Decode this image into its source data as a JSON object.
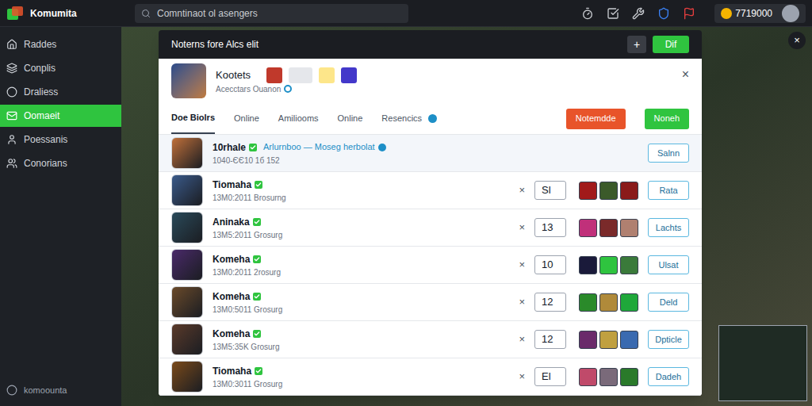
{
  "app": {
    "name": "Komumita"
  },
  "search": {
    "placeholder": "Comntinaot ol asengers"
  },
  "coins": "7719000",
  "sidebar": {
    "items": [
      {
        "label": "Raddes",
        "selected": false
      },
      {
        "label": "Conplis",
        "selected": false
      },
      {
        "label": "Draliess",
        "selected": false
      },
      {
        "label": "Oomaeit",
        "selected": true
      },
      {
        "label": "Poessanis",
        "selected": false
      },
      {
        "label": "Conorians",
        "selected": false
      }
    ],
    "footer": "komoounta"
  },
  "overlay_close": "×",
  "dialog": {
    "title": "Noterns fore Alcs elit",
    "add": "+",
    "confirm": "Dif",
    "close": "×",
    "profile": {
      "name": "Kootets",
      "subtitle": "Acecctars Ouanon"
    },
    "tabs": [
      {
        "label": "Doe Biolrs",
        "selected": true
      },
      {
        "label": "Online",
        "selected": false
      },
      {
        "label": "Amiliooms",
        "selected": false
      },
      {
        "label": "Online",
        "selected": false
      },
      {
        "label": "Resencics",
        "selected": false
      }
    ],
    "actions": [
      {
        "label": "Notemdde",
        "color": "#e8542a"
      },
      {
        "label": "Noneh",
        "color": "#2fc43f"
      }
    ],
    "rows": [
      {
        "kind": "request",
        "name": "10rhale",
        "link": "Arlurnboo — Moseg herbolat",
        "detail": "1040-ЄЄ10 1б 152",
        "button": "Salnn",
        "highlighted": true,
        "color": "#c0703a"
      },
      {
        "kind": "friend",
        "name": "Tiomaha",
        "detail": "13M0:2011 Brosurng",
        "remove": "×",
        "count": "Sl",
        "button": "Rata",
        "highlighted": false,
        "color": "#3a5a8a",
        "items": [
          {
            "color": "#a11a1a"
          },
          {
            "color": "#3b5a2a"
          },
          {
            "color": "#8a1a1a"
          }
        ]
      },
      {
        "kind": "friend",
        "name": "Aninaka",
        "detail": "13M5:2011 Grosurg",
        "remove": "×",
        "count": "13",
        "button": "Lachts",
        "highlighted": false,
        "color": "#2a4a5a",
        "items": [
          {
            "color": "#c0307a"
          },
          {
            "color": "#7a2a2a"
          },
          {
            "color": "#b08070"
          }
        ]
      },
      {
        "kind": "friend",
        "name": "Komeha",
        "detail": "13M0:2011 2rosurg",
        "remove": "×",
        "count": "10",
        "button": "Ulsat",
        "highlighted": false,
        "color": "#4a2a6a",
        "items": [
          {
            "color": "#1a1a3a"
          },
          {
            "color": "#2fc43f"
          },
          {
            "color": "#3a7a3a"
          }
        ]
      },
      {
        "kind": "friend",
        "name": "Komeha",
        "detail": "13M0:5011 Grosurg",
        "remove": "×",
        "count": "12",
        "button": "Deld",
        "highlighted": false,
        "color": "#6a4a2a",
        "items": [
          {
            "color": "#2a8a2a"
          },
          {
            "color": "#b08a3a"
          },
          {
            "color": "#1fa83a"
          }
        ]
      },
      {
        "kind": "friend",
        "name": "Komeha",
        "detail": "13M5:35K Grosurg",
        "remove": "×",
        "count": "12",
        "button": "Dpticle",
        "highlighted": false,
        "color": "#5a3a2a",
        "items": [
          {
            "color": "#6a2a6a"
          },
          {
            "color": "#c0a040"
          },
          {
            "color": "#3a6ab0"
          }
        ]
      },
      {
        "kind": "friend",
        "name": "Tiomaha",
        "detail": "13M0:3011 Grosurg",
        "remove": "×",
        "count": "El",
        "button": "Dadeh",
        "highlighted": false,
        "color": "#7a4a1a",
        "items": [
          {
            "color": "#c04a6a"
          },
          {
            "color": "#7a6a7a"
          },
          {
            "color": "#2a7a2a"
          }
        ]
      }
    ]
  }
}
